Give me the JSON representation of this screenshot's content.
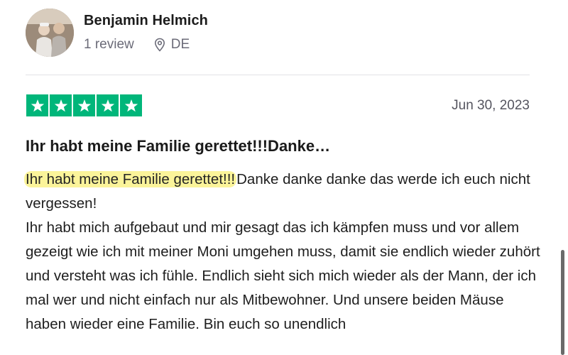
{
  "reviewer": {
    "name": "Benjamin Helmich",
    "review_count": "1 review",
    "country": "DE",
    "location_icon": "location-pin-icon"
  },
  "review": {
    "rating": 5,
    "rating_max": 5,
    "star_color": "#00b67a",
    "date": "Jun 30, 2023",
    "title": "Ihr habt meine Familie gerettet!!!Danke…",
    "highlighted": "Ihr habt meine Familie gerettet!!!",
    "highlight_color": "#fbf49a",
    "body": "Danke danke danke das werde ich euch nicht vergessen!\nIhr habt mich aufgebaut und mir gesagt das ich kämpfen muss und vor allem gezeigt wie ich mit meiner Moni umgehen muss, damit sie endlich wieder zuhört und versteht was ich fühle. Endlich sieht sich mich wieder als der Mann, der ich mal wer und nicht einfach nur als Mitbewohner. Und unsere beiden Mäuse haben wieder eine Familie. Bin euch so unendlich"
  }
}
